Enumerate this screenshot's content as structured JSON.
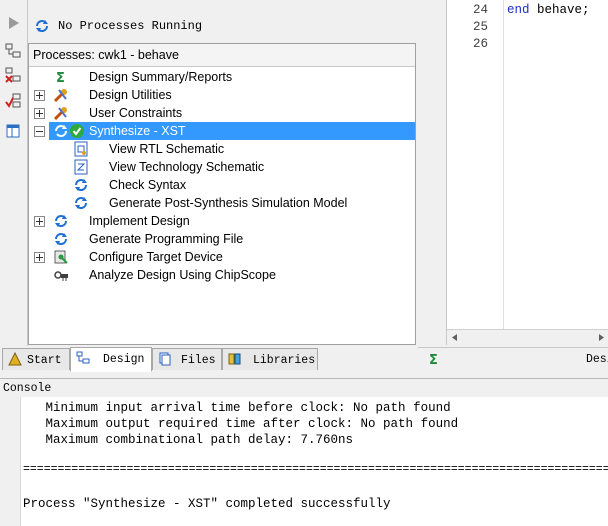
{
  "status": {
    "text": "No Processes Running"
  },
  "processes": {
    "header": "Processes: cwk1 - behave",
    "items": [
      {
        "label": "Design Summary/Reports"
      },
      {
        "label": "Design Utilities"
      },
      {
        "label": "User Constraints"
      },
      {
        "label": "Synthesize - XST"
      },
      {
        "label": "View RTL Schematic"
      },
      {
        "label": "View Technology Schematic"
      },
      {
        "label": "Check Syntax"
      },
      {
        "label": "Generate Post-Synthesis Simulation Model"
      },
      {
        "label": "Implement Design"
      },
      {
        "label": "Generate Programming File"
      },
      {
        "label": "Configure Target Device"
      },
      {
        "label": "Analyze Design Using ChipScope"
      }
    ]
  },
  "editor": {
    "lines": [
      {
        "num": "24",
        "keyword": "end",
        "rest": " behave;"
      },
      {
        "num": "25",
        "keyword": "",
        "rest": ""
      },
      {
        "num": "26",
        "keyword": "",
        "rest": ""
      }
    ]
  },
  "tabs": [
    {
      "label": "Start"
    },
    {
      "label": "Design"
    },
    {
      "label": "Files"
    },
    {
      "label": "Libraries"
    }
  ],
  "right_tab": {
    "label": "Desi"
  },
  "console": {
    "title": "Console",
    "lines": [
      "   Minimum input arrival time before clock: No path found",
      "   Maximum output required time after clock: No path found",
      "   Maximum combinational path delay: 7.760ns",
      "",
      "=======================================================================================",
      "",
      "Process \"Synthesize - XST\" completed successfully"
    ]
  },
  "colors": {
    "selection": "#3399ff",
    "keyword": "#1a2fd0",
    "success": "#2eaa3c"
  }
}
